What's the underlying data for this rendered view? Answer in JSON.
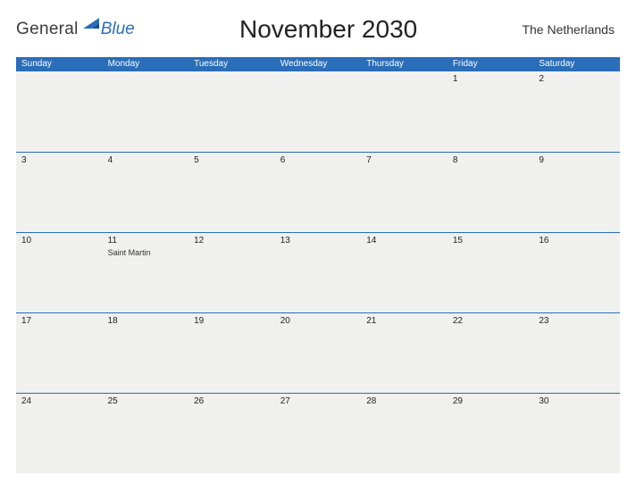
{
  "brand": {
    "part1": "General",
    "part2": "Blue"
  },
  "title": "November 2030",
  "country": "The Netherlands",
  "day_headers": [
    "Sunday",
    "Monday",
    "Tuesday",
    "Wednesday",
    "Thursday",
    "Friday",
    "Saturday"
  ],
  "weeks": [
    [
      {
        "n": ""
      },
      {
        "n": ""
      },
      {
        "n": ""
      },
      {
        "n": ""
      },
      {
        "n": ""
      },
      {
        "n": "1"
      },
      {
        "n": "2"
      }
    ],
    [
      {
        "n": "3"
      },
      {
        "n": "4"
      },
      {
        "n": "5"
      },
      {
        "n": "6"
      },
      {
        "n": "7"
      },
      {
        "n": "8"
      },
      {
        "n": "9"
      }
    ],
    [
      {
        "n": "10"
      },
      {
        "n": "11",
        "event": "Saint Martin"
      },
      {
        "n": "12"
      },
      {
        "n": "13"
      },
      {
        "n": "14"
      },
      {
        "n": "15"
      },
      {
        "n": "16"
      }
    ],
    [
      {
        "n": "17"
      },
      {
        "n": "18"
      },
      {
        "n": "19"
      },
      {
        "n": "20"
      },
      {
        "n": "21"
      },
      {
        "n": "22"
      },
      {
        "n": "23"
      }
    ],
    [
      {
        "n": "24"
      },
      {
        "n": "25"
      },
      {
        "n": "26"
      },
      {
        "n": "27"
      },
      {
        "n": "28"
      },
      {
        "n": "29"
      },
      {
        "n": "30"
      }
    ]
  ],
  "colors": {
    "accent": "#2a6db8",
    "cell_bg": "#f0f0ee"
  }
}
